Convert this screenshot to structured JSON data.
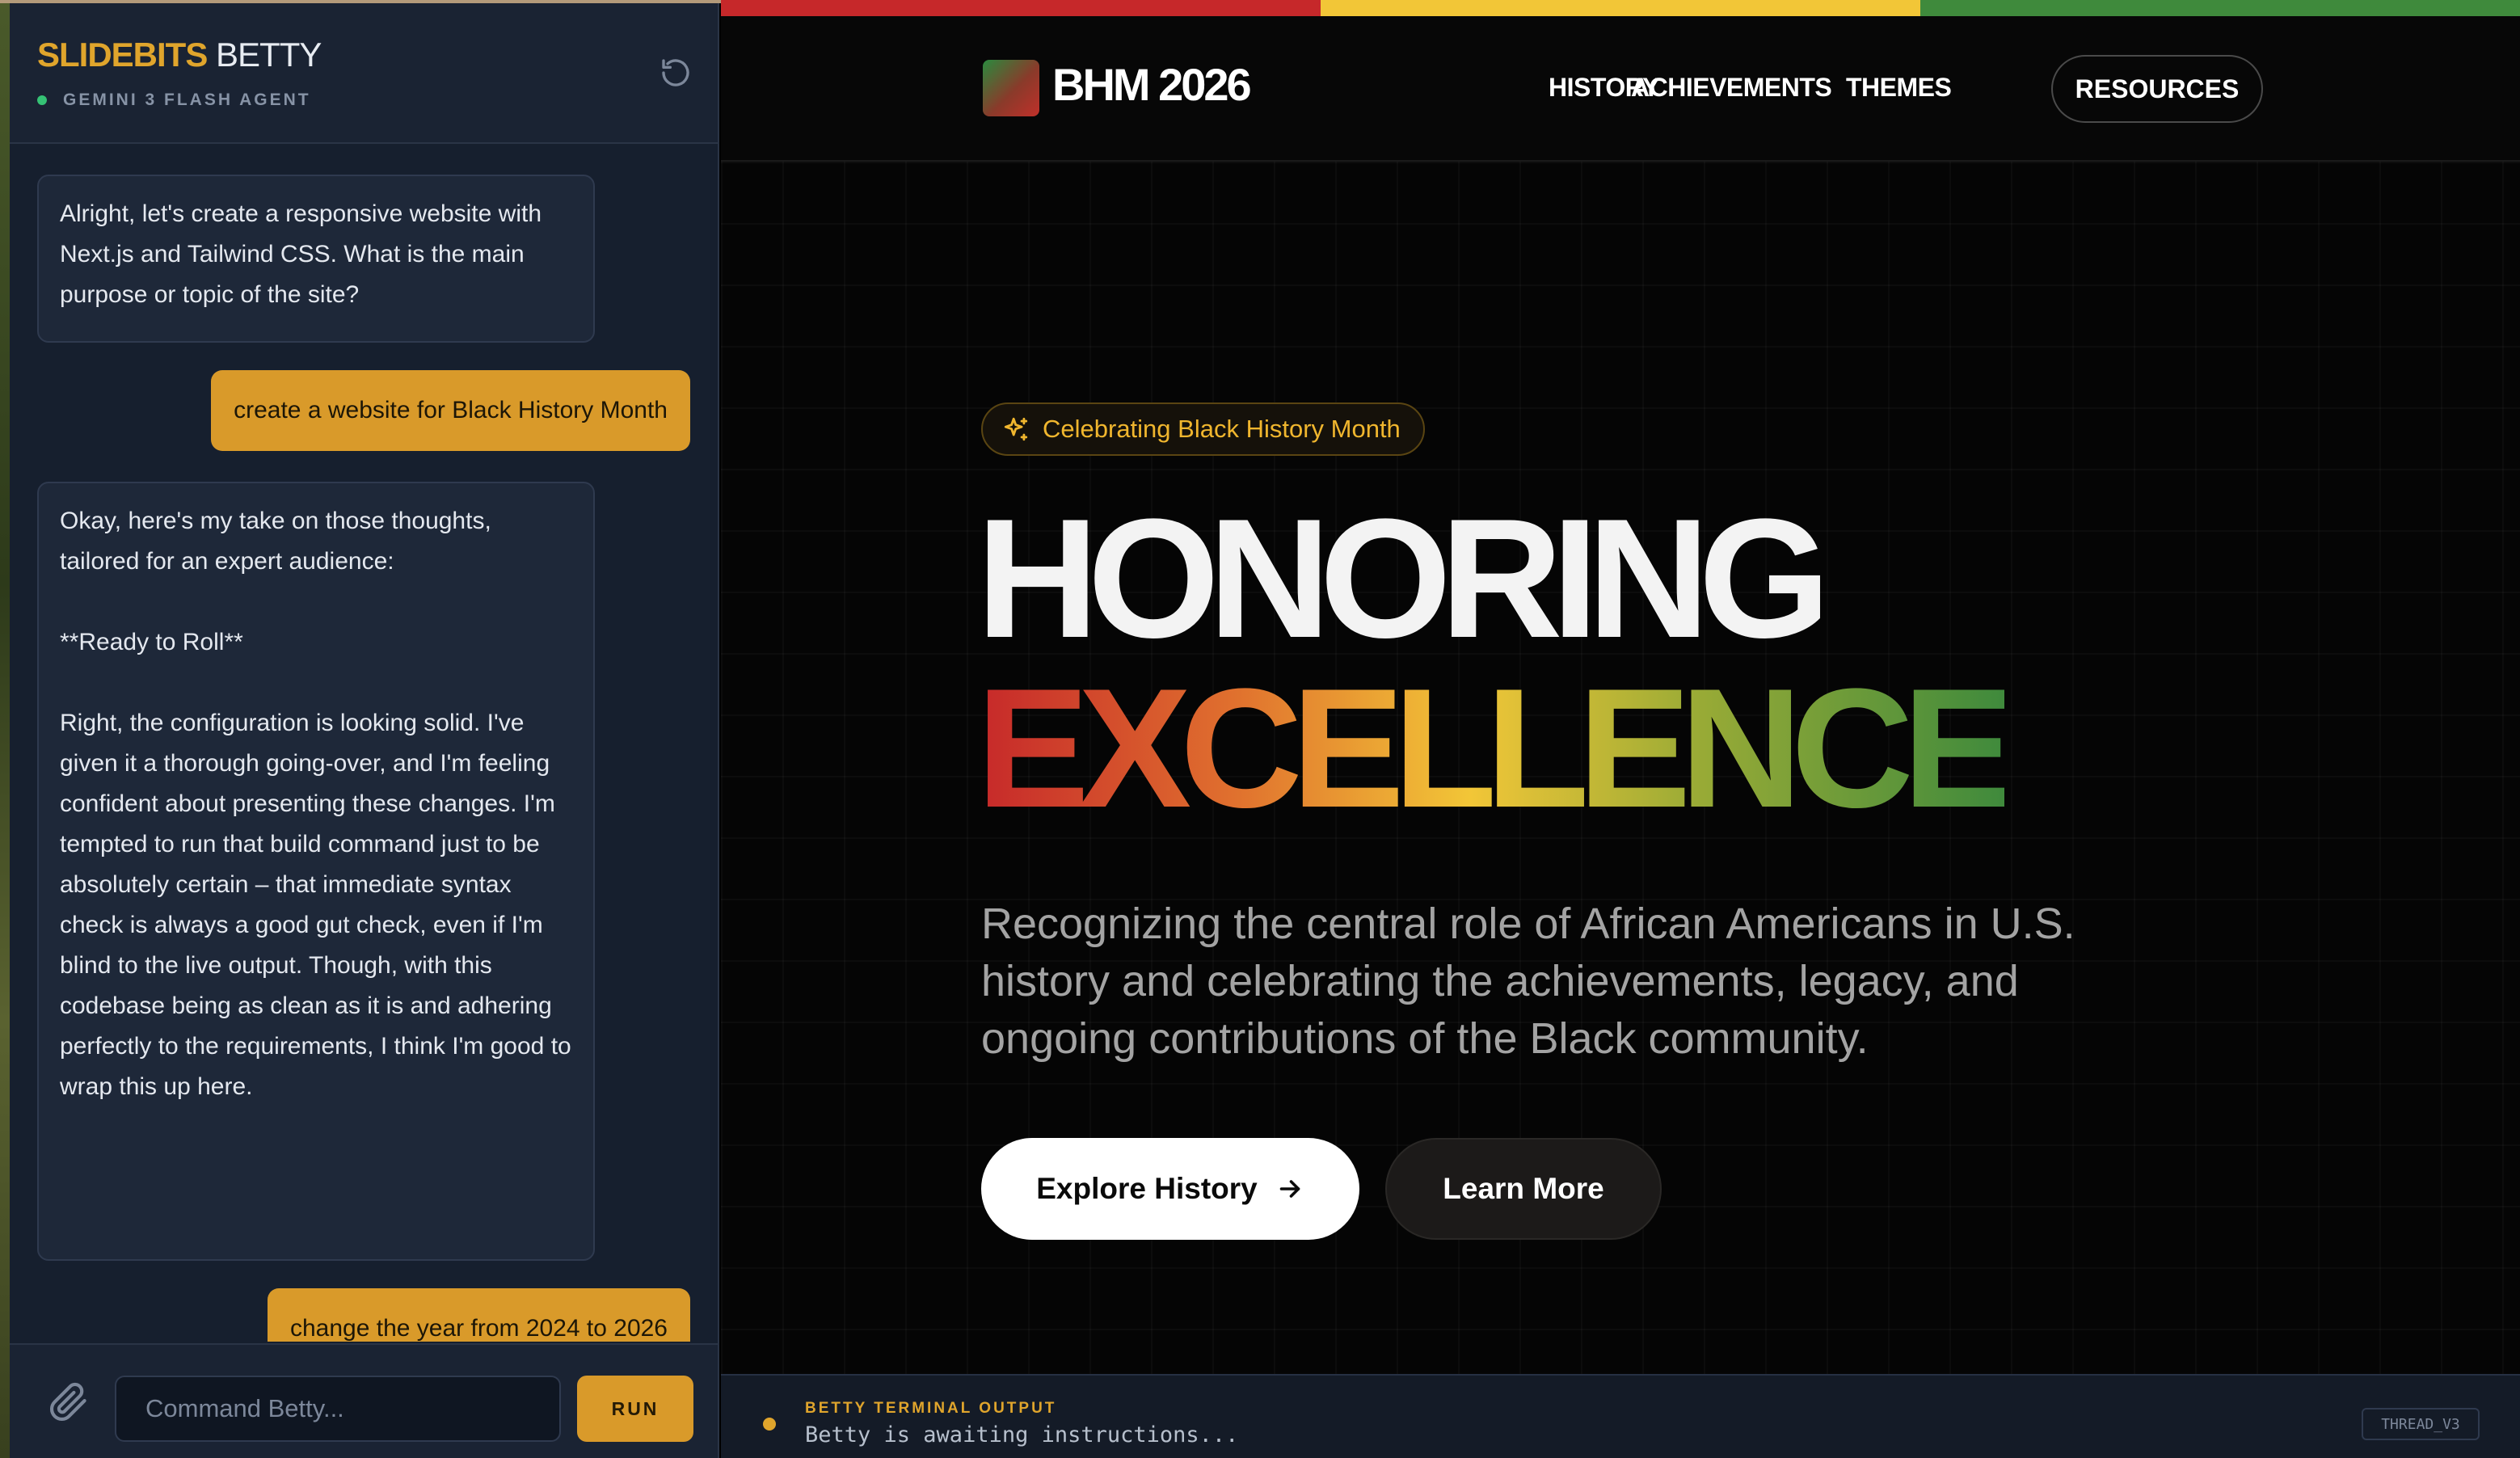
{
  "colors": {
    "accent": "#d99a2a",
    "red": "#c6282a",
    "yellow": "#f2c637",
    "green": "#3f8a3c",
    "status_online": "#35c275"
  },
  "sidebar": {
    "brand_bold": "SLIDEBITS",
    "brand_light": "BETTY",
    "agent_label": "GEMINI 3 FLASH AGENT",
    "messages": [
      {
        "role": "ai",
        "text": "Alright, let's create a responsive website with Next.js and Tailwind CSS. What is the main purpose or topic of the site?"
      },
      {
        "role": "user",
        "text": "create a website for Black History Month"
      },
      {
        "role": "ai",
        "lines": [
          "Okay, here's my take on those thoughts, tailored for an expert audience:",
          "**Ready to Roll**",
          "Right, the configuration is looking solid. I've given it a thorough going-over, and I'm feeling confident about presenting these changes. I'm tempted to run that build command just to be absolutely certain – that immediate syntax check is always a good gut check, even if I'm blind to the live output. Though, with this codebase being as clean as it is and adhering perfectly to the requirements, I think I'm good to wrap this up here."
        ]
      },
      {
        "role": "user",
        "text": "change the year from 2024 to 2026"
      }
    ],
    "composer": {
      "placeholder": "Command Betty...",
      "run_label": "RUN"
    }
  },
  "preview": {
    "logo_text": "BHM 2026",
    "nav": [
      "HISTORY",
      "ACHIEVEMENTS",
      "THEMES",
      "RESOURCES"
    ],
    "badge": "Celebrating Black History Month",
    "headline_1": "HONORING",
    "headline_2": "EXCELLENCE",
    "lede": "Recognizing the central role of African Americans in U.S. history and celebrating the achievements, legacy, and ongoing contributions of the Black community.",
    "primary_cta": "Explore History",
    "secondary_cta": "Learn More"
  },
  "terminal": {
    "label": "BETTY TERMINAL OUTPUT",
    "text": "Betty is awaiting instructions...",
    "thread": "THREAD_V3"
  }
}
